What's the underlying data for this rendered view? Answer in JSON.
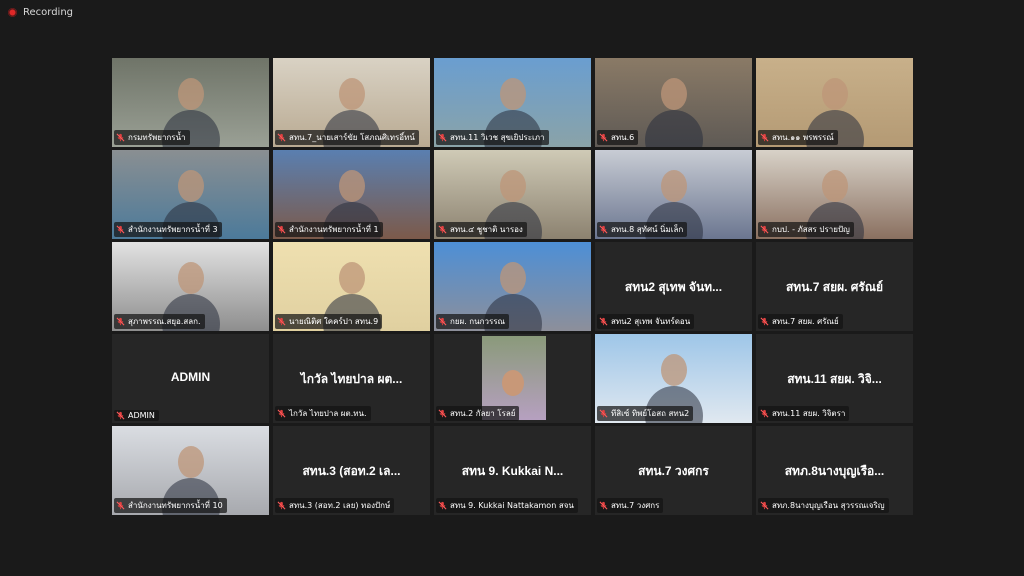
{
  "recording": {
    "label": "Recording"
  },
  "tiles": [
    {
      "name": "กรมทรัพยากรน้ำ",
      "c1": "#6f7468",
      "c2": "#9aa095",
      "active": true
    },
    {
      "name": "สทน.7_นายเสาร์ขัย โสภณศิเทรอิ์ทน์",
      "c1": "#d9d2c4",
      "c2": "#b9aa92"
    },
    {
      "name": "สทน.11 วิเวช สุขเยิประเภา",
      "c1": "#6a9ed0",
      "c2": "#8aa3a8"
    },
    {
      "name": "สทน.6",
      "c1": "#8a7a66",
      "c2": "#5f5a55"
    },
    {
      "name": "สทน.๑๑ พรพรรณ์",
      "c1": "#c8b08a",
      "c2": "#b49a74"
    },
    {
      "name": "สำนักงานทรัพยากรน้ำที่ 3",
      "c1": "#8a8f92",
      "c2": "#4c7a9a"
    },
    {
      "name": "สำนักงานทรัพยากรน้ำที่ 1",
      "c1": "#5a7fb0",
      "c2": "#7c5a4a"
    },
    {
      "name": "สทน.๔ ชูชาติ นารอง",
      "c1": "#cfcab6",
      "c2": "#8c8270"
    },
    {
      "name": "สทน.8 สุทัศน์ นิ่มเล็ก",
      "c1": "#c8ccd4",
      "c2": "#6b7690"
    },
    {
      "name": "กบป. - ภัสสร ปรายปัญ",
      "c1": "#d8d2c8",
      "c2": "#8a7060"
    },
    {
      "name": "สุภาพรรณ.สยุอ.สลก.",
      "c1": "#e2e2e2",
      "c2": "#8e8e8e"
    },
    {
      "name": "นายณิติศ ใคคร์ปา สทน.9",
      "c1": "#efe0b0",
      "c2": "#e0d0a0"
    },
    {
      "name": "กยผ. กนกวรรณ",
      "c1": "#4d8fd6",
      "c2": "#8d8f9a"
    },
    {
      "name": "สทน2 สุเทพ จันทร์ดอน",
      "big": "สทน2 สุเทพ จันท..."
    },
    {
      "name": "สทน.7 สยผ. ศรัณย์",
      "big": "สทน.7 สยผ. ศรัณย์"
    },
    {
      "name": "ADMIN",
      "big": "ADMIN"
    },
    {
      "name": "ไกวัล ไทยปาล ผต.ทน.",
      "big": "ไกวัล ไทยปาล ผต..."
    },
    {
      "name": "สทน.2 กัลยา โรลย์",
      "c1": "#8a9a7a",
      "c2": "#b6a0c0",
      "inset": true
    },
    {
      "name": "ทีสิเซ์ ทิพย์โอสถ สทน2",
      "c1": "#9ec6e8",
      "c2": "#e0e8f0"
    },
    {
      "name": "สทน.11 สยผ. วิจิตรา",
      "big": "สทน.11 สยผ. วิจิ..."
    },
    {
      "name": "สำนักงานทรัพยากรน้ำที่ 10",
      "c1": "#dadde2",
      "c2": "#a7a9ae"
    },
    {
      "name": "สทน.3 (สอท.2 เลย) ทองปักษ์",
      "big": "สทน.3 (สอท.2 เล..."
    },
    {
      "name": "สทน 9. Kukkai Nattakamon สจน",
      "big": "สทน 9. Kukkai N..."
    },
    {
      "name": "สทน.7 วงศกร",
      "big": "สทน.7 วงศกร"
    },
    {
      "name": "สทภ.8นางบุญเรือน สุวรรณเจริญ",
      "big": "สทภ.8นางบุญเรือ..."
    }
  ]
}
